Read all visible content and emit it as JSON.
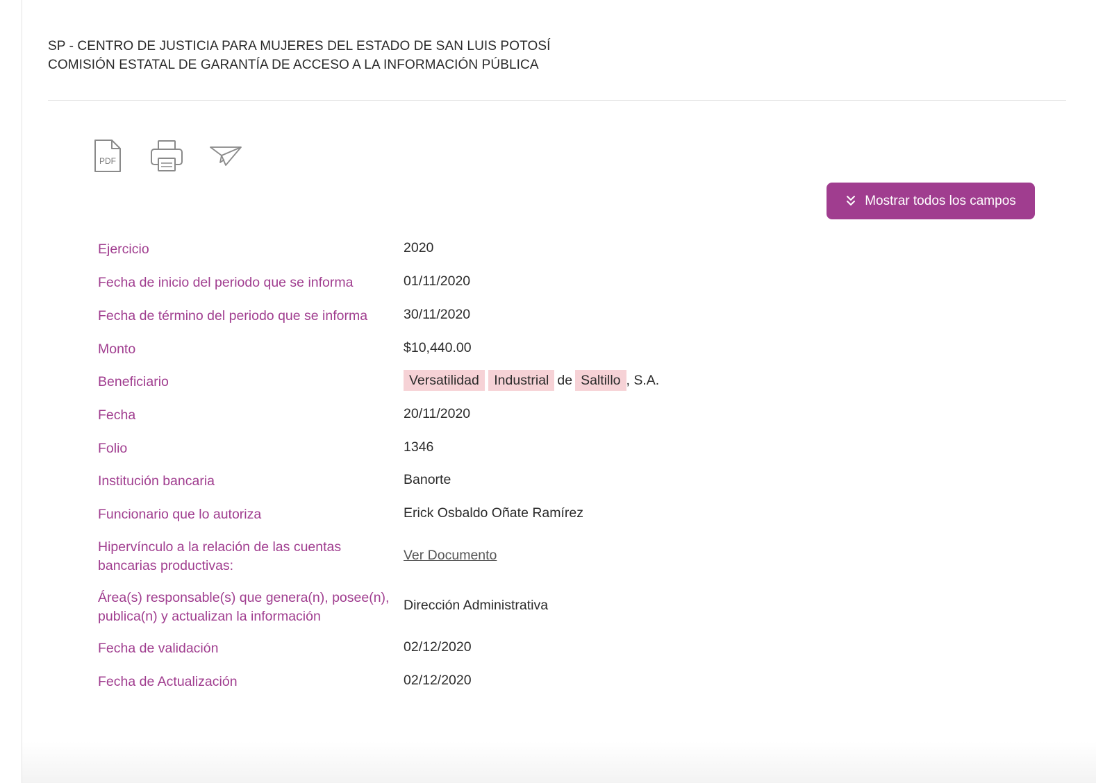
{
  "header": {
    "line1": "SP - CENTRO DE JUSTICIA PARA MUJERES DEL ESTADO DE SAN LUIS POTOSÍ",
    "line2": "COMISIÓN ESTATAL DE GARANTÍA DE ACCESO A LA INFORMACIÓN PÚBLICA"
  },
  "toolbar": {
    "pdf_text": "PDF",
    "icons": [
      "pdf-icon",
      "printer-icon",
      "paper-plane-icon"
    ]
  },
  "show_all_button": {
    "label": "Mostrar todos los campos",
    "icon": "chevrons-down-icon",
    "color": "#a03d8f"
  },
  "colors": {
    "label": "#a03d8f",
    "highlight": "#f6d2d6"
  },
  "fields": [
    {
      "label": "Ejercicio",
      "value": "2020"
    },
    {
      "label": "Fecha de inicio del periodo que se informa",
      "value": "01/11/2020"
    },
    {
      "label": "Fecha de término del periodo que se informa",
      "value": "30/11/2020"
    },
    {
      "label": "Monto",
      "value": "$10,440.00"
    },
    {
      "label": "Beneficiario",
      "value_parts": [
        "Versatilidad",
        "Industrial",
        "de",
        "Saltillo",
        ", S.A."
      ]
    },
    {
      "label": "Fecha",
      "value": "20/11/2020"
    },
    {
      "label": "Folio",
      "value": "1346"
    },
    {
      "label": "Institución bancaria",
      "value": "Banorte"
    },
    {
      "label": "Funcionario que lo autoriza",
      "value": "Erick Osbaldo Oñate Ramírez"
    },
    {
      "label_line1": "Hipervínculo a la relación de las cuentas",
      "label_line2": "bancarias productivas:",
      "link": "Ver Documento"
    },
    {
      "label_line1": "Área(s) responsable(s) que genera(n), posee(n),",
      "label_line2": "publica(n) y actualizan la información",
      "value": "Dirección Administrativa"
    },
    {
      "label": "Fecha de validación",
      "value": "02/12/2020"
    },
    {
      "label": "Fecha de Actualización",
      "value": "02/12/2020"
    }
  ]
}
